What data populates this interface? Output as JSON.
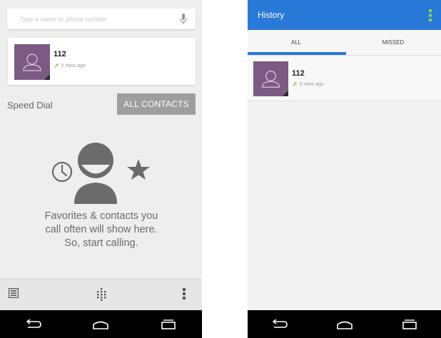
{
  "left_screen": {
    "search": {
      "placeholder": "Type a name or phone number",
      "icon": "mic-icon"
    },
    "recent_call": {
      "number": "112",
      "time": "0 mins ago",
      "direction_icon": "outgoing-arrow-icon"
    },
    "speed_dial_label": "Speed Dial",
    "all_contacts_label": "ALL CONTACTS",
    "empty_state": {
      "line1": "Favorites & contacts you",
      "line2": "call often will show here.",
      "line3": "So, start calling."
    },
    "bottom_bar": {
      "icons": [
        "call-history-icon",
        "dialpad-icon",
        "overflow-menu-icon"
      ]
    }
  },
  "right_screen": {
    "title": "History",
    "tabs": [
      {
        "label": "ALL",
        "selected": true
      },
      {
        "label": "MISSED",
        "selected": false
      }
    ],
    "calls": [
      {
        "number": "112",
        "time": "0 mins ago"
      }
    ]
  },
  "colors": {
    "accent_blue": "#2979d8",
    "avatar_purple": "#7c5a84",
    "outgoing_green": "#8bc34a"
  }
}
